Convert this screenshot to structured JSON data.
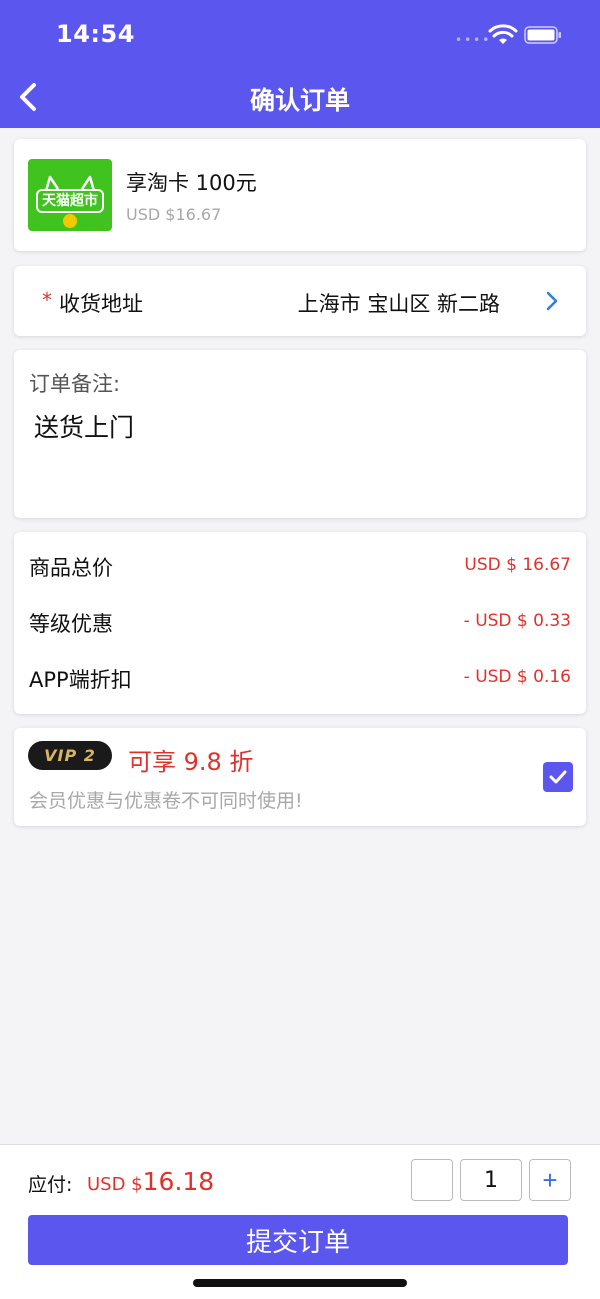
{
  "status_bar": {
    "time": "14:54",
    "dots": "••••"
  },
  "header": {
    "title": "确认订单"
  },
  "product": {
    "logo_text": "天猫超市",
    "name": "享淘卡 100元",
    "price": "USD $16.67"
  },
  "address": {
    "required_mark": "*",
    "label": "收货地址",
    "value": "上海市 宝山区 新二路"
  },
  "notes": {
    "label": "订单备注:",
    "value": "送货上门"
  },
  "summary": {
    "rows": [
      {
        "label": "商品总价",
        "value": "USD $ 16.67"
      },
      {
        "label": "等级优惠",
        "value": "- USD $ 0.33"
      },
      {
        "label": "APP端折扣",
        "value": "- USD $ 0.16"
      }
    ]
  },
  "vip": {
    "badge": "VIP 2",
    "discount": "可享 9.8 折",
    "note": "会员优惠与优惠卷不可同时使用!",
    "checked": true
  },
  "footer": {
    "pay_label": "应付:",
    "pay_currency": "USD $",
    "pay_amount": "16.18",
    "quantity": "1",
    "plus": "+",
    "submit_label": "提交订单"
  },
  "colors": {
    "accent": "#5b57ee",
    "price_red": "#e0322c",
    "muted_gray": "#a8a8a8",
    "logo_green": "#40c21f"
  }
}
